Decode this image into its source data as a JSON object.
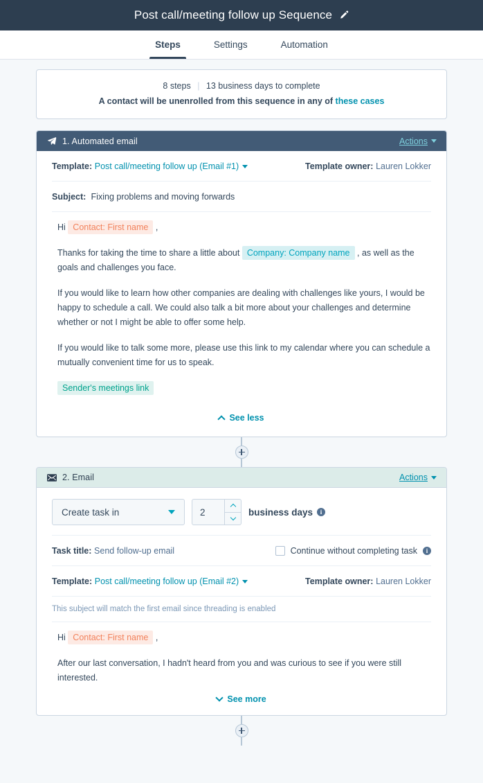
{
  "header": {
    "title": "Post call/meeting follow up Sequence",
    "edit_icon": "pencil-icon"
  },
  "tabs": [
    {
      "label": "Steps",
      "active": true
    },
    {
      "label": "Settings",
      "active": false
    },
    {
      "label": "Automation",
      "active": false
    }
  ],
  "summary": {
    "steps_count": "8 steps",
    "separator": "|",
    "duration": "13 business days to complete",
    "unenroll_text": "A contact will be unenrolled from this sequence in any of ",
    "unenroll_link": "these cases"
  },
  "steps": [
    {
      "index": "1.",
      "icon": "paper-plane-icon",
      "title": "1. Automated email",
      "header_style": "dark",
      "actions_label": "Actions",
      "template_label": "Template:",
      "template_name": "Post call/meeting follow up (Email #1)",
      "template_owner_label": "Template owner:",
      "template_owner": "Lauren Lokker",
      "subject_label": "Subject:",
      "subject": "Fixing problems and moving forwards",
      "greeting_prefix": "Hi",
      "greeting_token": "Contact: First name",
      "greeting_suffix": ",",
      "body_p1_before": "Thanks for taking the time to share a little about",
      "body_p1_token": "Company: Company name",
      "body_p1_after": ", as well as the goals and challenges you face.",
      "body_p2": "If you would like to learn how other companies are dealing with challenges like yours, I would be happy to schedule a call. We could also talk a bit more about your challenges and determine whether or not I might be able to offer some help.",
      "body_p3": "If you would like to talk some more, please use this link to my calendar where you can schedule a mutually convenient time for us to speak.",
      "meeting_token": "Sender's meetings link",
      "toggle_label": "See less",
      "toggle_dir": "up"
    },
    {
      "index": "2.",
      "icon": "envelope-icon",
      "title": "2. Email",
      "header_style": "mint",
      "actions_label": "Actions",
      "task_select_value": "Create task in",
      "delay_value": "2",
      "delay_unit": "business days",
      "task_title_label": "Task title:",
      "task_title": "Send follow-up email",
      "continue_checkbox_label": "Continue without completing task",
      "template_label": "Template:",
      "template_name": "Post call/meeting follow up (Email #2)",
      "template_owner_label": "Template owner:",
      "template_owner": "Lauren Lokker",
      "threading_note": "This subject will match the first email since threading is enabled",
      "greeting_prefix": "Hi",
      "greeting_token": "Contact: First name",
      "greeting_suffix": ",",
      "body_p1": "After our last conversation, I hadn't heard from you and was curious to see if you were still interested.",
      "toggle_label": "See more",
      "toggle_dir": "down"
    }
  ],
  "colors": {
    "topbar_bg": "#2d3e50",
    "step1_header_bg": "#425b76",
    "step2_header_bg": "#dcece9",
    "page_bg": "#f5f8fa",
    "link": "#0091ae",
    "token_contact": "#f2825c",
    "token_company": "#00a4bd",
    "token_meeting": "#00a38d"
  },
  "add_step_button": "+"
}
